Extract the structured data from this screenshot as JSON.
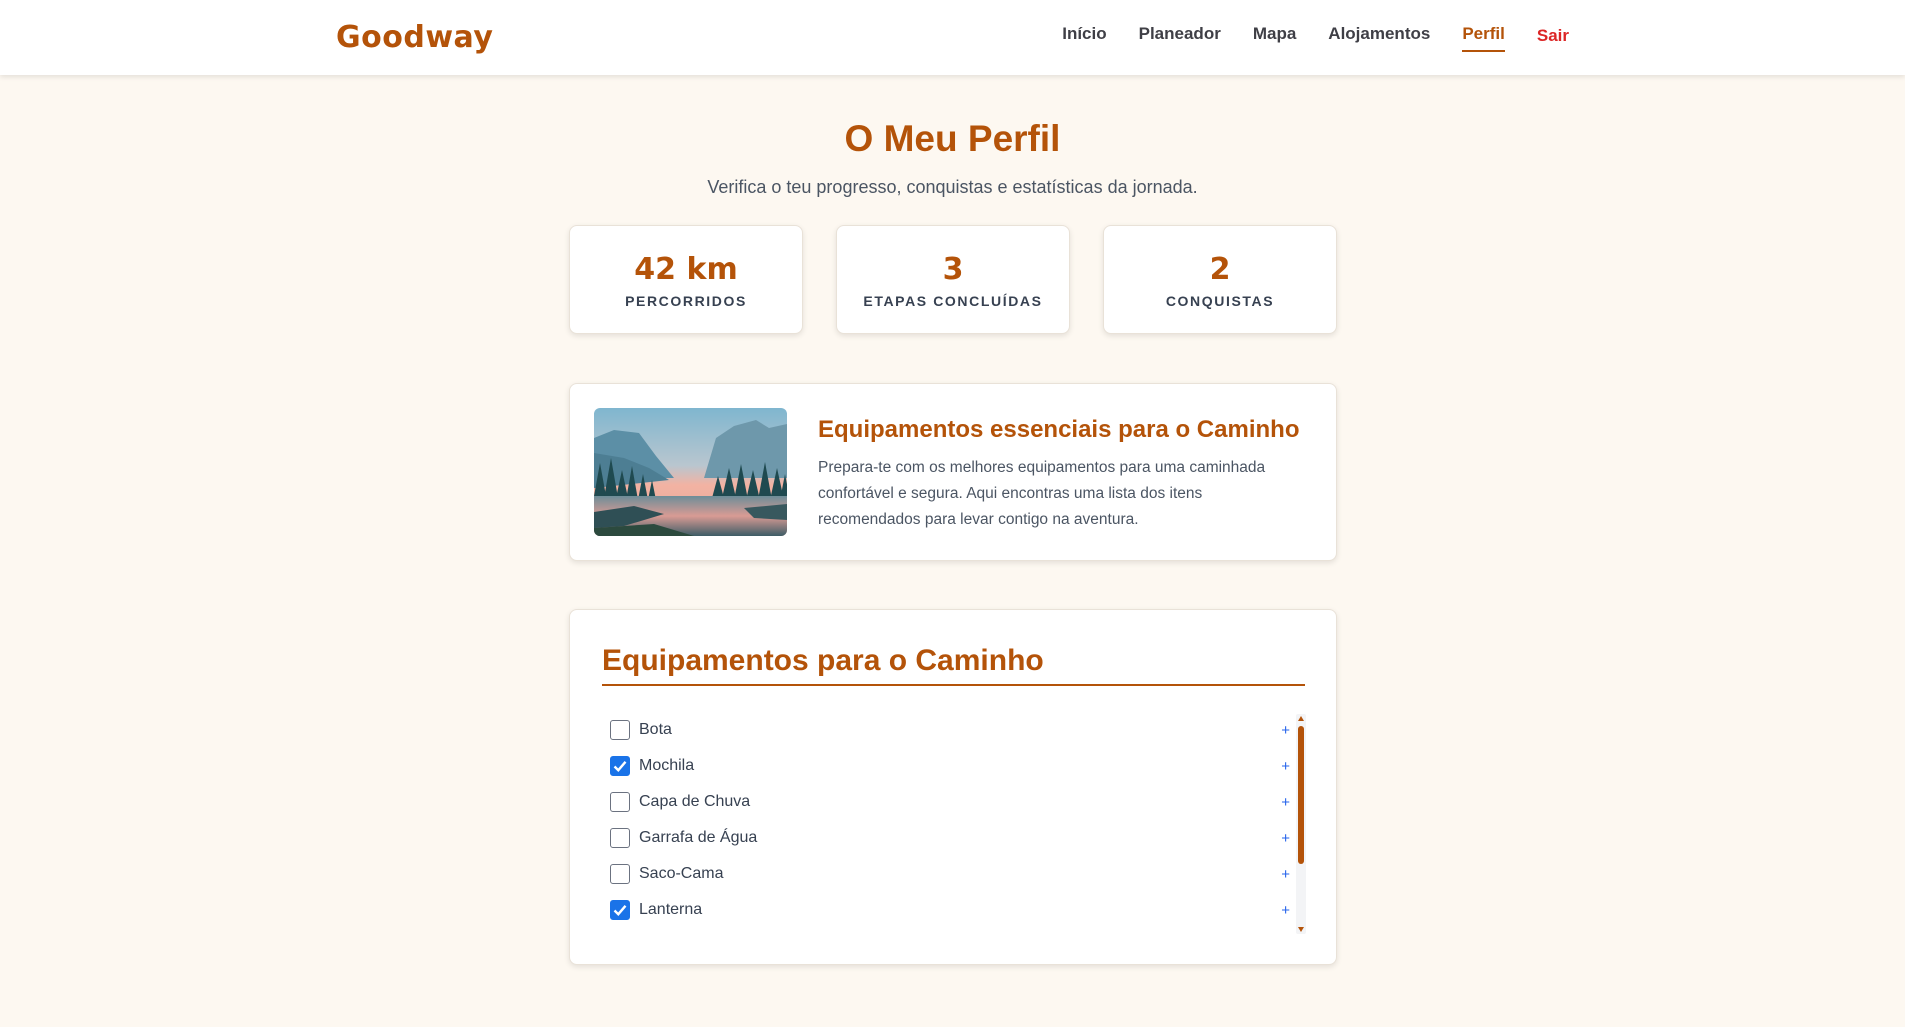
{
  "header": {
    "brand": "Goodway",
    "nav": [
      {
        "label": "Início",
        "active": false
      },
      {
        "label": "Planeador",
        "active": false
      },
      {
        "label": "Mapa",
        "active": false
      },
      {
        "label": "Alojamentos",
        "active": false
      },
      {
        "label": "Perfil",
        "active": true
      }
    ],
    "logout_label": "Sair"
  },
  "page": {
    "title": "O Meu Perfil",
    "subtitle": "Verifica o teu progresso, conquistas e estatísticas da jornada."
  },
  "stats": [
    {
      "value": "42 km",
      "label": "Percorridos"
    },
    {
      "value": "3",
      "label": "Etapas concluídas"
    },
    {
      "value": "2",
      "label": "Conquistas"
    }
  ],
  "feature": {
    "image_alt": "mountain-lake-landscape",
    "title": "Equipamentos essenciais para o Caminho",
    "text": "Prepara-te com os melhores equipamentos para uma caminhada confortável e segura. Aqui encontras uma lista dos itens recomendados para levar contigo na aventura."
  },
  "equipment": {
    "title": "Equipamentos para o Caminho",
    "add_symbol": "+",
    "items": [
      {
        "label": "Bota",
        "checked": false
      },
      {
        "label": "Mochila",
        "checked": true
      },
      {
        "label": "Capa de Chuva",
        "checked": false
      },
      {
        "label": "Garrafa de Água",
        "checked": false
      },
      {
        "label": "Saco-Cama",
        "checked": false
      },
      {
        "label": "Lanterna",
        "checked": true
      },
      {
        "label": "",
        "checked": false
      }
    ]
  },
  "colors": {
    "accent": "#b45309",
    "background": "#fdf8f1",
    "logout": "#dc2626",
    "checkbox": "#1a73e8",
    "add_link": "#2563eb"
  }
}
